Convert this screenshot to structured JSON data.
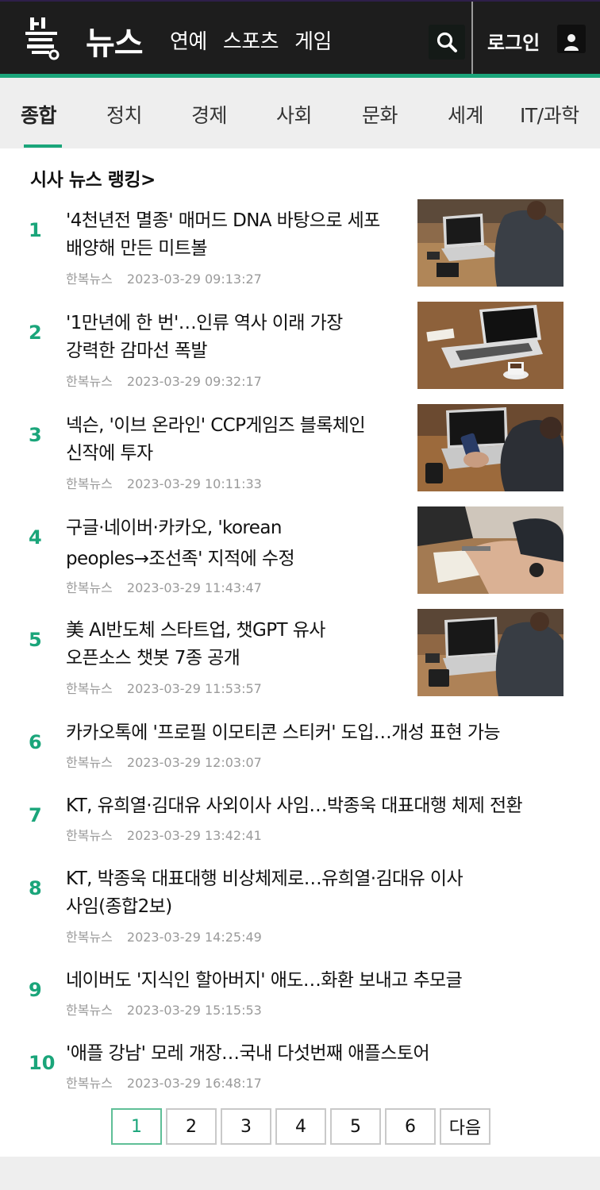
{
  "header": {
    "brand": "뉴스",
    "nav": [
      "연예",
      "스포츠",
      "게임"
    ],
    "login_label": "로그인",
    "icons": [
      "site-logo",
      "search-icon",
      "user-icon"
    ]
  },
  "categories": {
    "active_index": 0,
    "items": [
      "종합",
      "정치",
      "경제",
      "사회",
      "문화",
      "세계",
      "IT/과학"
    ]
  },
  "ranking": {
    "title": "시사 뉴스 랭킹>",
    "items": [
      {
        "rank": "1",
        "headline": [
          "'4천년전 멸종' 매머드 DNA 바탕으로 세포",
          "배양해 만든 미트볼"
        ],
        "source": "한복뉴스",
        "time": "2023-03-29 09:13:27",
        "has_thumb": true
      },
      {
        "rank": "2",
        "headline": [
          "'1만년에 한 번'…인류 역사 이래 가장",
          "강력한 감마선 폭발"
        ],
        "source": "한복뉴스",
        "time": "2023-03-29 09:32:17",
        "has_thumb": true
      },
      {
        "rank": "3",
        "headline": [
          "넥슨, '이브 온라인' CCP게임즈 블록체인",
          "신작에 투자"
        ],
        "source": "한복뉴스",
        "time": "2023-03-29 10:11:33",
        "has_thumb": true
      },
      {
        "rank": "4",
        "headline": [
          "구글·네이버·카카오, 'korean",
          "peoples→조선족' 지적에 수정"
        ],
        "source": "한복뉴스",
        "time": "2023-03-29 11:43:47",
        "has_thumb": true
      },
      {
        "rank": "5",
        "headline": [
          "美 AI반도체 스타트업, 챗GPT 유사",
          "오픈소스 챗봇 7종 공개"
        ],
        "source": "한복뉴스",
        "time": "2023-03-29 11:53:57",
        "has_thumb": true
      },
      {
        "rank": "6",
        "headline": [
          "카카오톡에 '프로필 이모티콘 스티커' 도입…개성 표현 가능"
        ],
        "source": "한복뉴스",
        "time": "2023-03-29 12:03:07",
        "has_thumb": false
      },
      {
        "rank": "7",
        "headline": [
          "KT, 유희열·김대유 사외이사 사임…박종욱 대표대행 체제 전환"
        ],
        "source": "한복뉴스",
        "time": "2023-03-29 13:42:41",
        "has_thumb": false
      },
      {
        "rank": "8",
        "headline": [
          "KT, 박종욱 대표대행 비상체제로…유희열·김대유 이사",
          "사임(종합2보)"
        ],
        "source": "한복뉴스",
        "time": "2023-03-29 14:25:49",
        "has_thumb": false
      },
      {
        "rank": "9",
        "headline": [
          "네이버도 '지식인 할아버지' 애도…화환 보내고 추모글"
        ],
        "source": "한복뉴스",
        "time": "2023-03-29 15:15:53",
        "has_thumb": false
      },
      {
        "rank": "10",
        "headline": [
          "'애플 강남' 모레 개장…국내 다섯번째 애플스토어"
        ],
        "source": "한복뉴스",
        "time": "2023-03-29 16:48:17",
        "has_thumb": false
      }
    ]
  },
  "pagination": {
    "active_index": 0,
    "pages": [
      "1",
      "2",
      "3",
      "4",
      "5",
      "6"
    ],
    "next_label": "다음"
  },
  "colors": {
    "accent": "#1aa57a",
    "header_bg": "#1d1d1d",
    "tab_bar_bg": "#eeeeee",
    "meta_text": "#9a9a9a"
  }
}
